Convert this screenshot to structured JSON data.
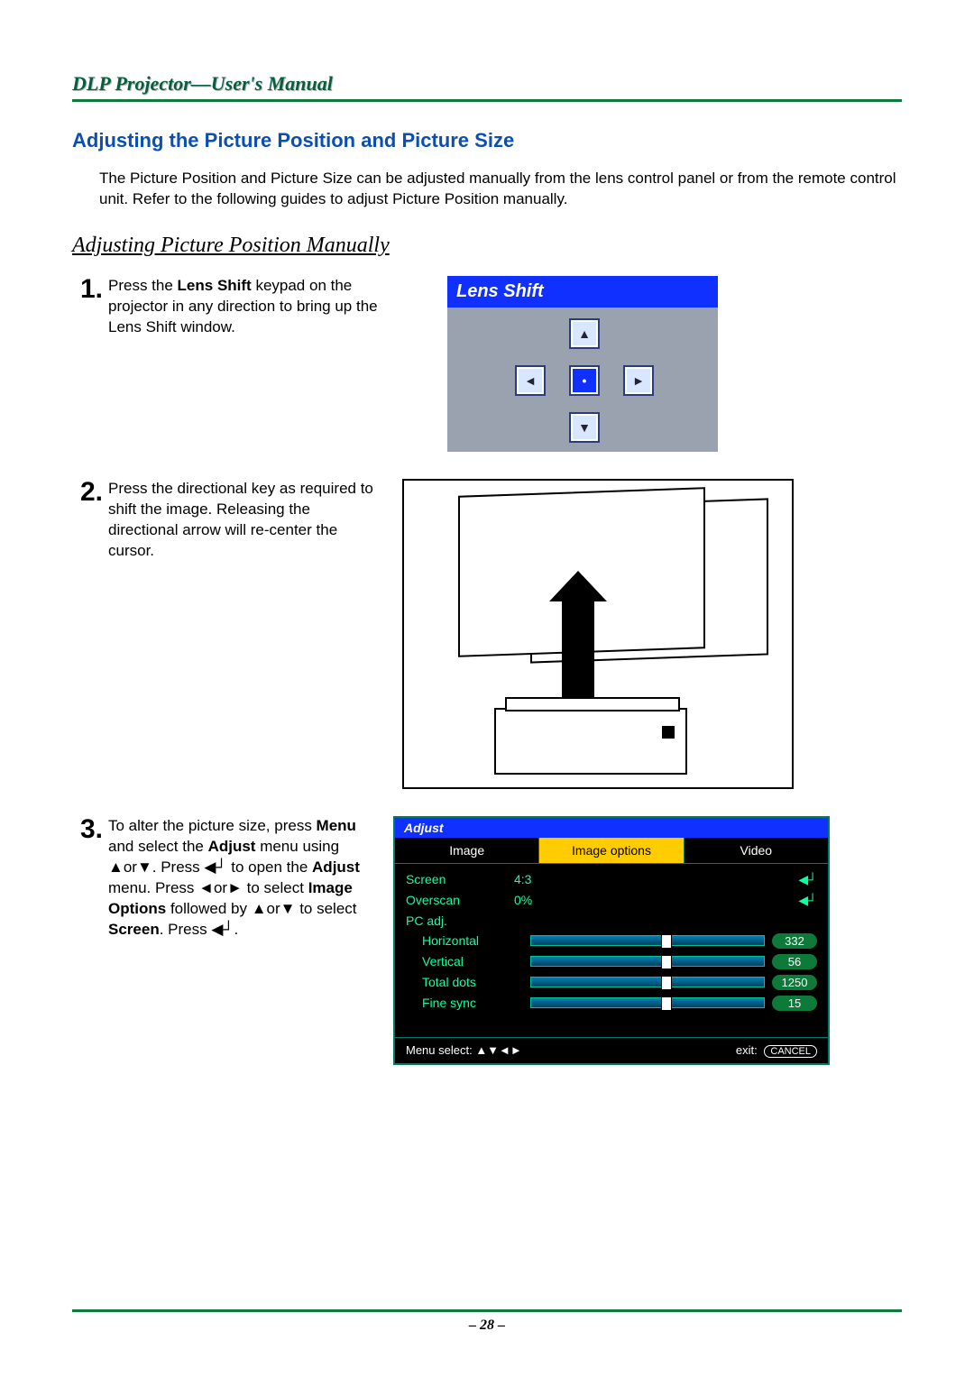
{
  "header": {
    "title": "DLP Projector—User's Manual"
  },
  "section": {
    "heading": "Adjusting the Picture Position and Picture Size"
  },
  "intro": "The Picture Position and Picture Size can be adjusted manually from the lens control panel or from the remote control unit. Refer to the following guides to adjust Picture Position manually.",
  "subheading": "Adjusting Picture Position Manually",
  "steps": {
    "s1": {
      "num": "1.",
      "text_a": "Press the ",
      "bold_a": "Lens Shift",
      "text_b": " keypad on the projector in any direction to bring up the Lens Shift window."
    },
    "s2": {
      "num": "2.",
      "text": "Press the directional key as required to shift the image. Releasing the directional arrow will re-center the cursor."
    },
    "s3": {
      "num": "3.",
      "text_a": "To alter the picture size, press ",
      "bold_a": "Menu",
      "text_b": " and select the ",
      "bold_b": "Adjust",
      "text_c": " menu using ▲or▼. Press ◀┘ to open the ",
      "bold_c": "Adjust",
      "text_d": " menu. Press ◄or► to select ",
      "bold_d": "Image Options",
      "text_e": " followed by ▲or▼ to select ",
      "bold_e": "Screen",
      "text_f": ". Press ◀┘."
    }
  },
  "lens_panel": {
    "title": "Lens Shift",
    "up": "▲",
    "down": "▼",
    "left": "◄",
    "right": "►",
    "center": "•"
  },
  "osd": {
    "title": "Adjust",
    "tabs": {
      "image": "Image",
      "image_options": "Image options",
      "video": "Video"
    },
    "rows": {
      "screen": {
        "label": "Screen",
        "value": "4:3",
        "enter": "◀┘"
      },
      "overscan": {
        "label": "Overscan",
        "value": "0%",
        "enter": "◀┘"
      },
      "pcadj": {
        "label": "PC adj."
      },
      "horizontal": {
        "label": "Horizontal",
        "badge": "332"
      },
      "vertical": {
        "label": "Vertical",
        "badge": "56"
      },
      "totaldots": {
        "label": "Total dots",
        "badge": "1250"
      },
      "finesync": {
        "label": "Fine sync",
        "badge": "15"
      }
    },
    "footer": {
      "menu_select": "Menu select:  ▲▼◄►",
      "exit": "exit:",
      "cancel": "CANCEL"
    }
  },
  "page_number": "– 28 –"
}
